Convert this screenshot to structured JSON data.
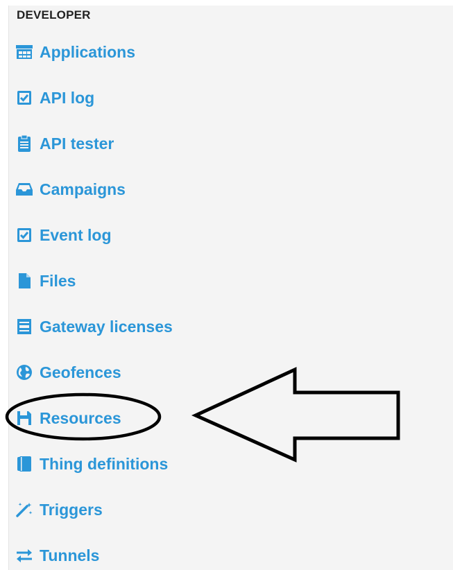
{
  "section": {
    "title": "DEVELOPER"
  },
  "menu": {
    "items": [
      {
        "label": "Applications",
        "icon": "storefront-icon"
      },
      {
        "label": "API log",
        "icon": "checkbox-icon"
      },
      {
        "label": "API tester",
        "icon": "clipboard-icon"
      },
      {
        "label": "Campaigns",
        "icon": "inbox-icon"
      },
      {
        "label": "Event log",
        "icon": "checkbox-icon"
      },
      {
        "label": "Files",
        "icon": "file-icon"
      },
      {
        "label": "Gateway licenses",
        "icon": "list-card-icon"
      },
      {
        "label": "Geofences",
        "icon": "globe-icon"
      },
      {
        "label": "Resources",
        "icon": "floppy-disk-icon"
      },
      {
        "label": "Thing definitions",
        "icon": "book-icon"
      },
      {
        "label": "Triggers",
        "icon": "magic-wand-icon"
      },
      {
        "label": "Tunnels",
        "icon": "exchange-arrows-icon"
      }
    ]
  },
  "colors": {
    "accent": "#2b96d8",
    "panel_background": "#f4f4f4",
    "title_text": "#222222",
    "annotation": "#000000"
  },
  "annotation": {
    "target": "Resources",
    "shapes": [
      "ellipse",
      "left-arrow"
    ]
  }
}
